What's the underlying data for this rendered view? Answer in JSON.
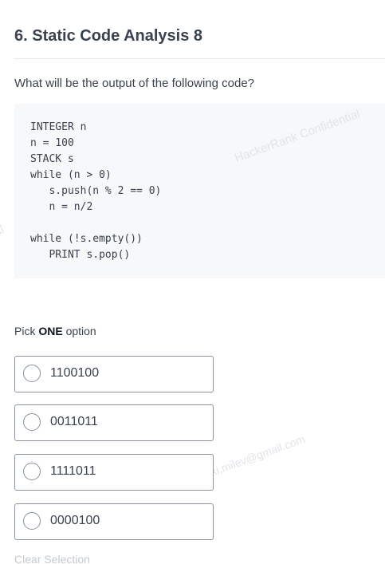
{
  "question": {
    "title": "6. Static Code Analysis 8",
    "prompt": "What will be the output of the following code?",
    "code_lines": [
      "INTEGER n",
      "n = 100",
      "STACK s",
      "while (n > 0)",
      "   s.push(n % 2 == 0)",
      "   n = n/2",
      "",
      "while (!s.empty())",
      "   PRINT s.pop()"
    ]
  },
  "watermarks": {
    "company": "HackerRank Confidential",
    "email": "idaki.milev@gmail.com",
    "left_fragment": "al"
  },
  "answer": {
    "pick_prefix": "Pick ",
    "pick_emphasis": "ONE",
    "pick_suffix": " option",
    "options": [
      {
        "label": "1100100",
        "selected": false
      },
      {
        "label": "0011011",
        "selected": false
      },
      {
        "label": "1111011",
        "selected": false
      },
      {
        "label": "0000100",
        "selected": false
      }
    ],
    "clear_label": "Clear Selection"
  }
}
